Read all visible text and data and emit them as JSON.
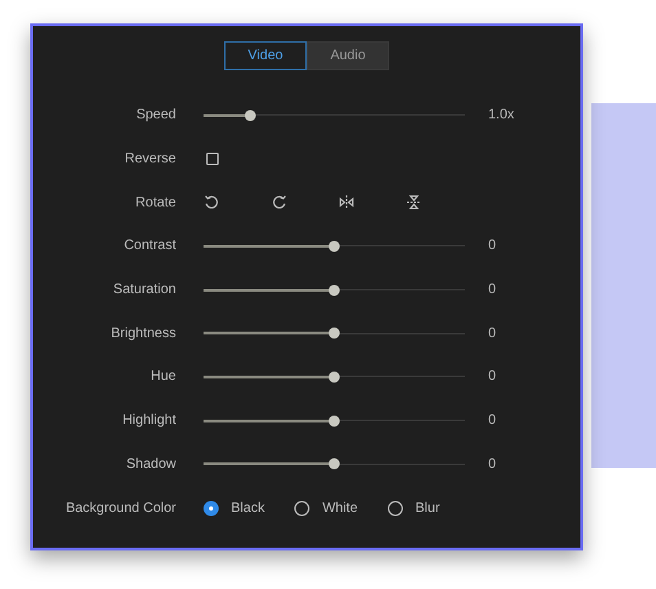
{
  "tabs": [
    {
      "label": "Video",
      "selected": true
    },
    {
      "label": "Audio",
      "selected": false
    }
  ],
  "rows": [
    {
      "kind": "slider",
      "label": "Speed",
      "level": 0.18,
      "reading": "1.0x"
    },
    {
      "kind": "checkbox",
      "label": "Reverse",
      "checked": false
    },
    {
      "kind": "rotate",
      "label": "Rotate"
    },
    {
      "kind": "slider",
      "label": "Contrast",
      "level": 0.5,
      "reading": "0"
    },
    {
      "kind": "slider",
      "label": "Saturation",
      "level": 0.5,
      "reading": "0"
    },
    {
      "kind": "slider",
      "label": "Brightness",
      "level": 0.5,
      "reading": "0"
    },
    {
      "kind": "slider",
      "label": "Hue",
      "level": 0.5,
      "reading": "0"
    },
    {
      "kind": "slider",
      "label": "Highlight",
      "level": 0.5,
      "reading": "0"
    },
    {
      "kind": "slider",
      "label": "Shadow",
      "level": 0.5,
      "reading": "0"
    },
    {
      "kind": "radio",
      "label": "Background Color",
      "options": [
        {
          "label": "Black",
          "selected": true
        },
        {
          "label": "White",
          "selected": false
        },
        {
          "label": "Blur",
          "selected": false
        }
      ]
    }
  ]
}
